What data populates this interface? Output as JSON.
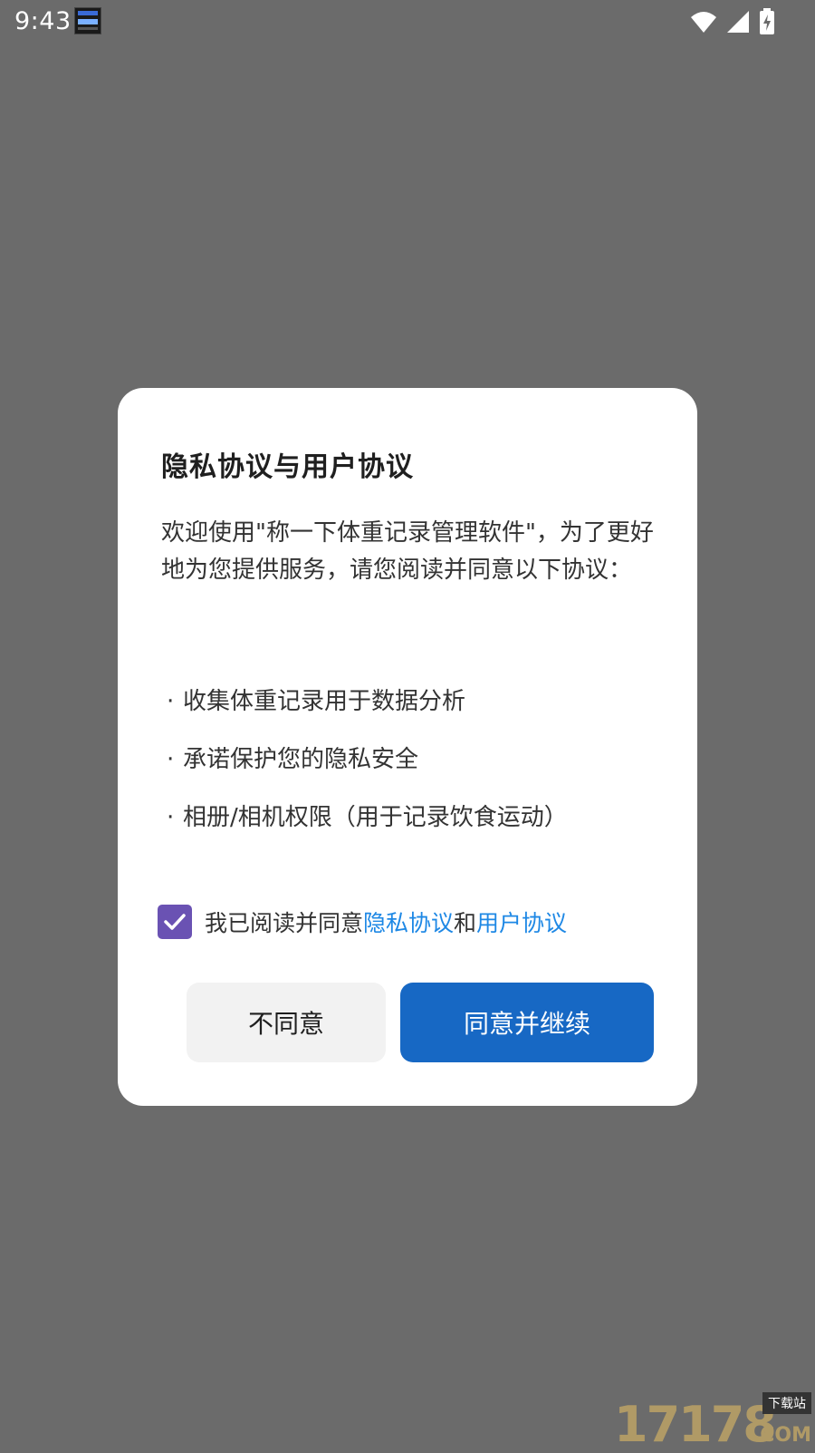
{
  "status_bar": {
    "time": "9:43",
    "icons": [
      "notification-app-icon",
      "wifi-icon",
      "cellular-signal-icon",
      "battery-charging-icon"
    ]
  },
  "dialog": {
    "title": "隐私协议与用户协议",
    "intro": "欢迎使用\"称一下体重记录管理软件\"，为了更好地为您提供服务，请您阅读并同意以下协议：",
    "bullets": [
      "收集体重记录用于数据分析",
      "承诺保护您的隐私安全",
      "相册/相机权限（用于记录饮食运动）"
    ],
    "bullet_symbol": "·",
    "agreement": {
      "checked": true,
      "prefix": "我已阅读并同意",
      "privacy_link": "隐私协议",
      "conjunction": "和",
      "user_link": "用户协议"
    },
    "buttons": {
      "decline": "不同意",
      "accept": "同意并继续"
    }
  },
  "watermark": {
    "number": "17178",
    "tag": "下载站",
    "suffix": ".COM"
  },
  "colors": {
    "backdrop": "#6b6b6b",
    "dialog_bg": "#ffffff",
    "accent_button": "#1768c4",
    "link": "#1e88e5",
    "checkbox": "#6a52b3",
    "secondary_button": "#f2f2f2"
  }
}
